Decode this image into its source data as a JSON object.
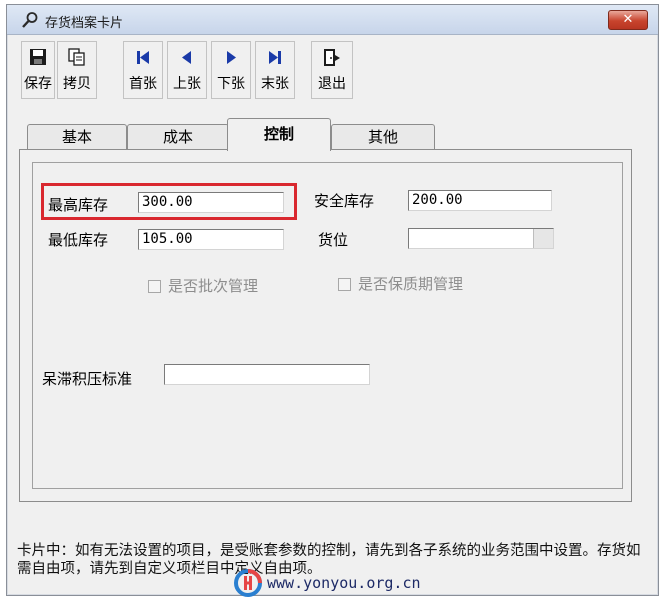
{
  "window": {
    "title": "存货档案卡片",
    "close_label": "✕"
  },
  "toolbar": {
    "save": "保存",
    "copy": "拷贝",
    "first": "首张",
    "prev": "上张",
    "next": "下张",
    "last": "末张",
    "exit": "退出"
  },
  "tabs": [
    {
      "label": "基本"
    },
    {
      "label": "成本"
    },
    {
      "label": "控制"
    },
    {
      "label": "其他"
    }
  ],
  "form": {
    "max_stock_label": "最高库存",
    "max_stock_value": "300.00",
    "safety_stock_label": "安全库存",
    "safety_stock_value": "200.00",
    "min_stock_label": "最低库存",
    "min_stock_value": "105.00",
    "location_label": "货位",
    "location_value": "",
    "batch_mgmt_label": "是否批次管理",
    "shelf_life_label": "是否保质期管理",
    "stagnant_label": "呆滞积压标准",
    "stagnant_value": ""
  },
  "status": {
    "text": "卡片中：如有无法设置的项目，是受账套参数的控制，请先到各子系统的业务范围中设置。存货如需自由项，请先到自定义项栏目中定义自由项。"
  },
  "watermark": {
    "url": "www.yonyou.org.cn"
  },
  "colors": {
    "highlight": "#d9282f",
    "close_button": "#c8442d",
    "nav_arrow": "#1a3aa8"
  }
}
